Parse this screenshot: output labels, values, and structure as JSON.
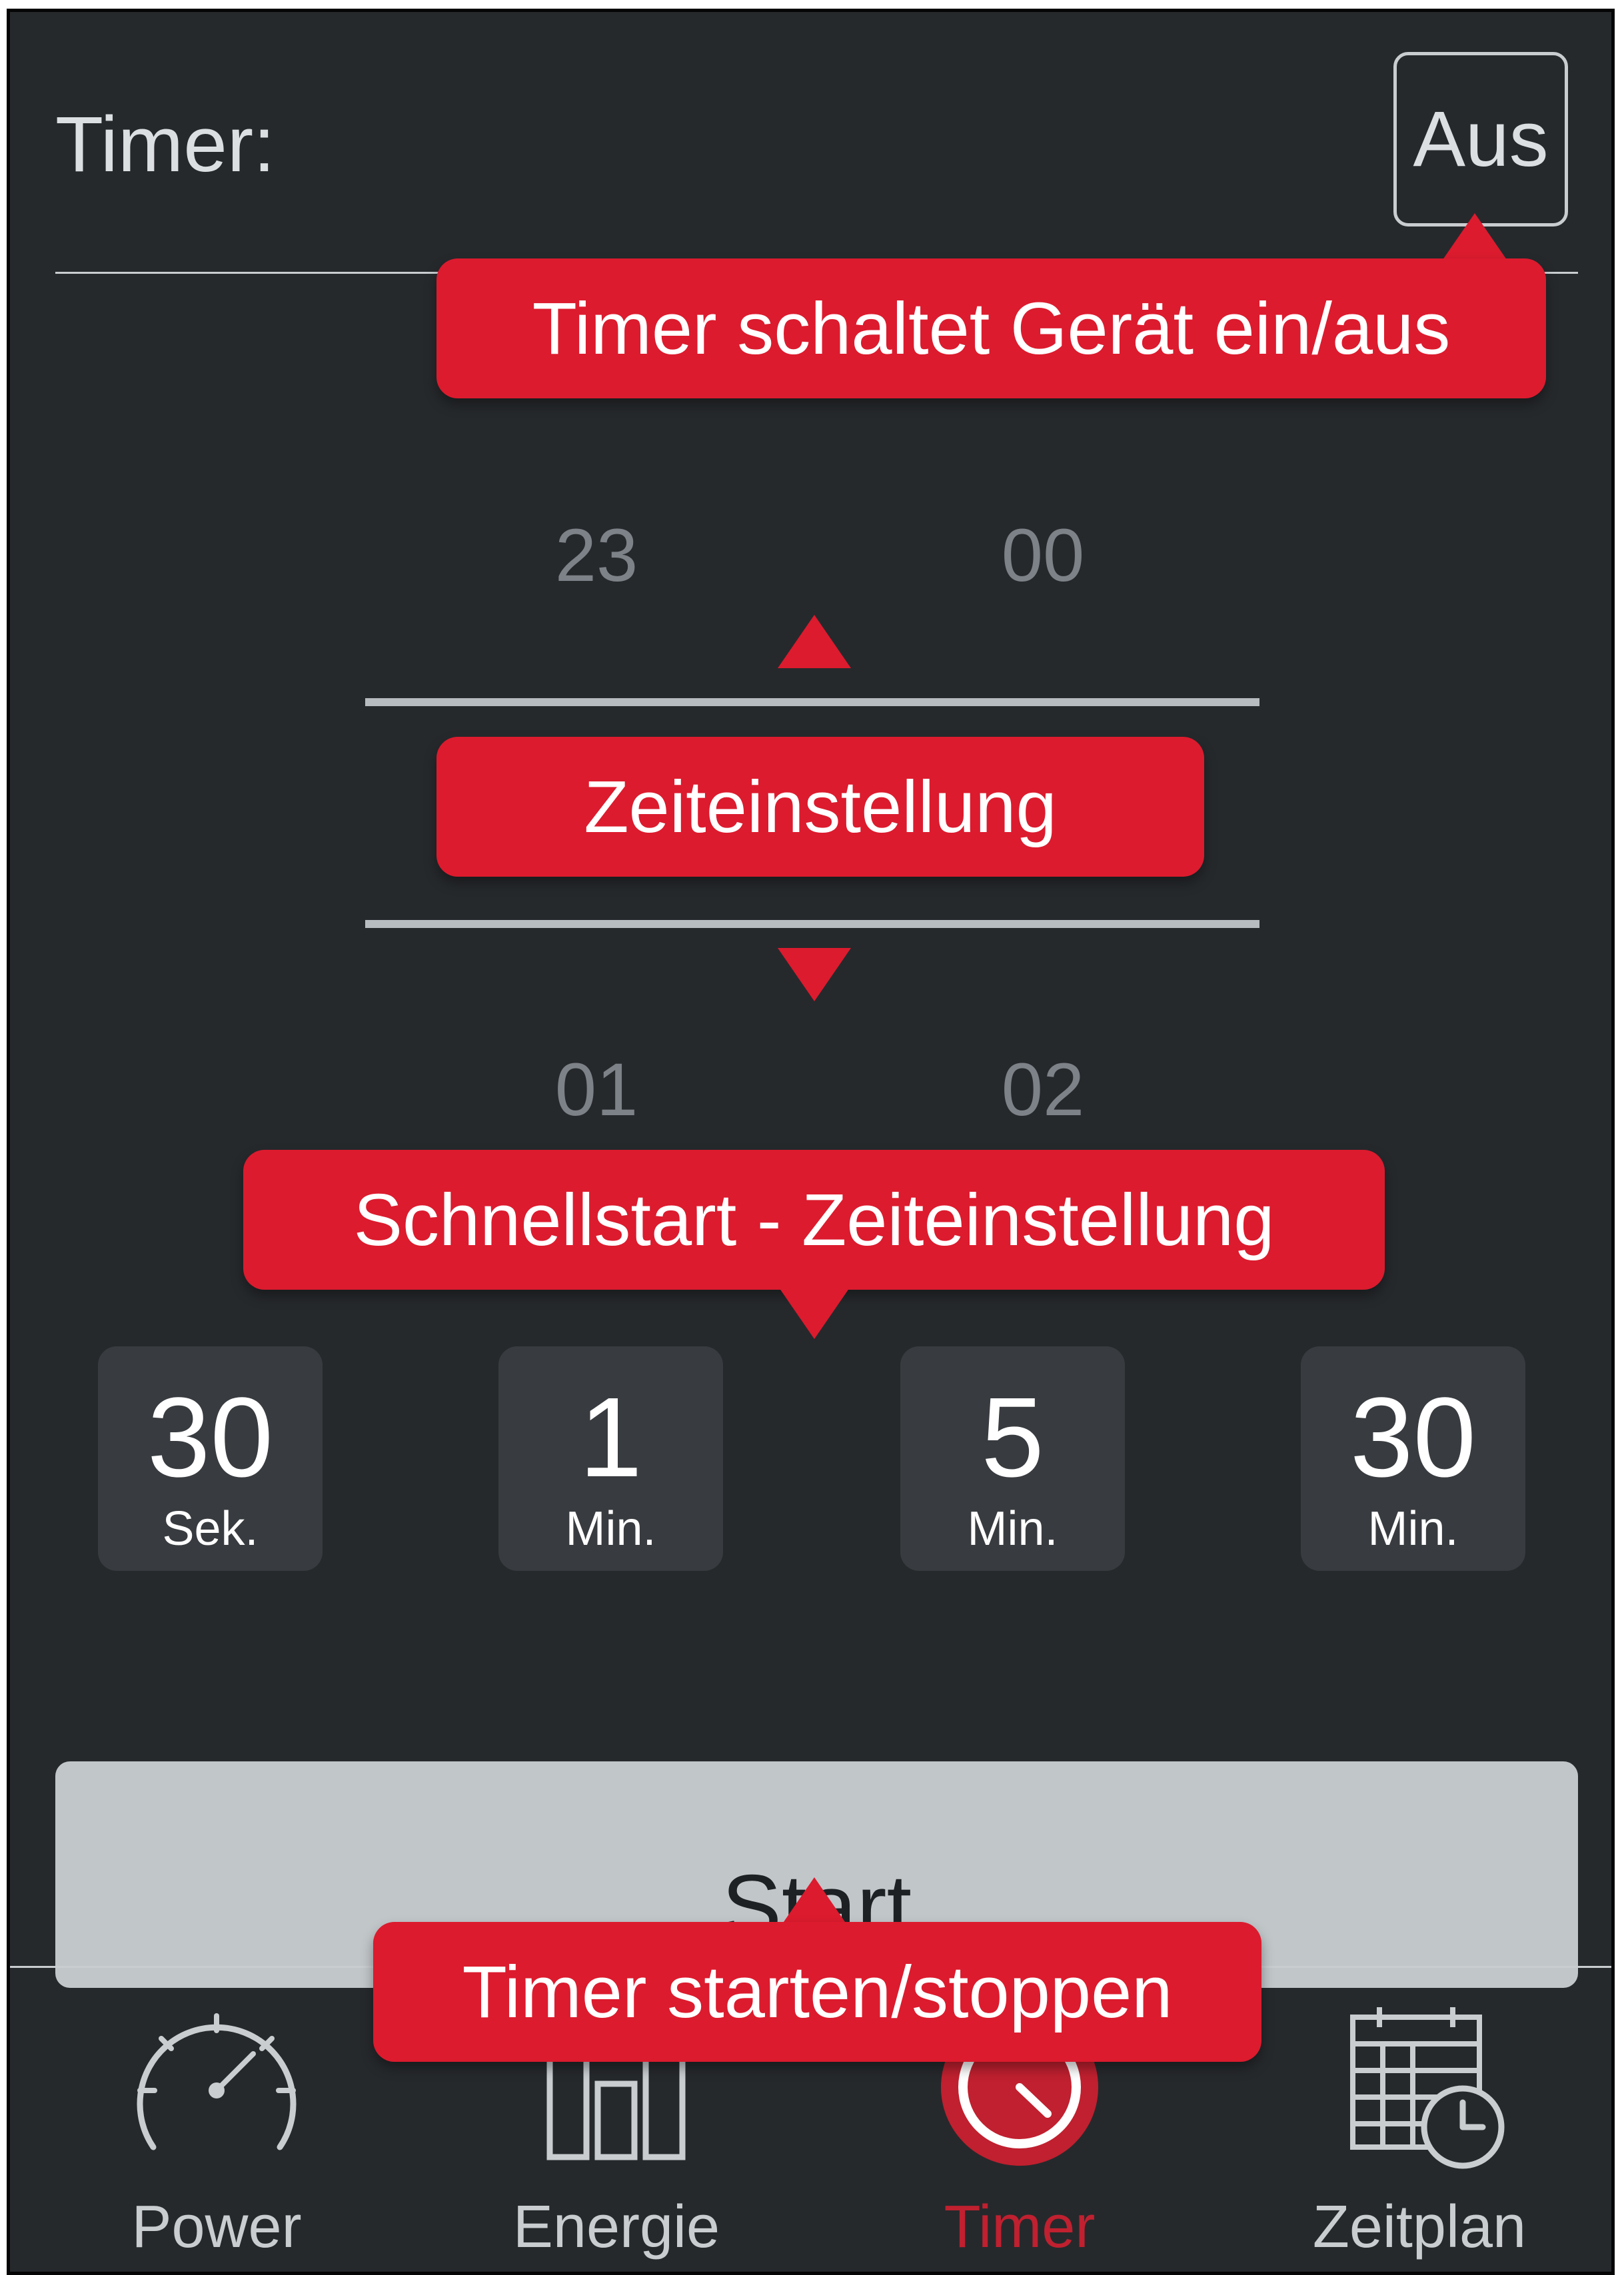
{
  "header": {
    "title": "Timer:",
    "toggle_label": "Aus"
  },
  "picker": {
    "above_hour": "23",
    "above_minute": "00",
    "below_hour": "01",
    "below_minute": "02"
  },
  "quick_start": [
    {
      "value": "30",
      "unit": "Sek."
    },
    {
      "value": "1",
      "unit": "Min."
    },
    {
      "value": "5",
      "unit": "Min."
    },
    {
      "value": "30",
      "unit": "Min."
    }
  ],
  "start_button": {
    "label": "Start"
  },
  "nav": {
    "items": [
      {
        "label": "Power",
        "icon": "speedometer-icon",
        "active": false
      },
      {
        "label": "Energie",
        "icon": "bar-chart-icon",
        "active": false
      },
      {
        "label": "Timer",
        "icon": "timer-icon",
        "active": true
      },
      {
        "label": "Zeitplan",
        "icon": "calendar-clock-icon",
        "active": false
      }
    ]
  },
  "callouts": {
    "toggle": "Timer schaltet Gerät ein/aus",
    "picker": "Zeiteinstellung",
    "quick_start": "Schnellstart - Zeiteinstellung",
    "start": "Timer starten/stoppen"
  },
  "colors": {
    "background": "#26292c",
    "accent": "#dc1b2e",
    "active_nav": "#c0202f"
  }
}
